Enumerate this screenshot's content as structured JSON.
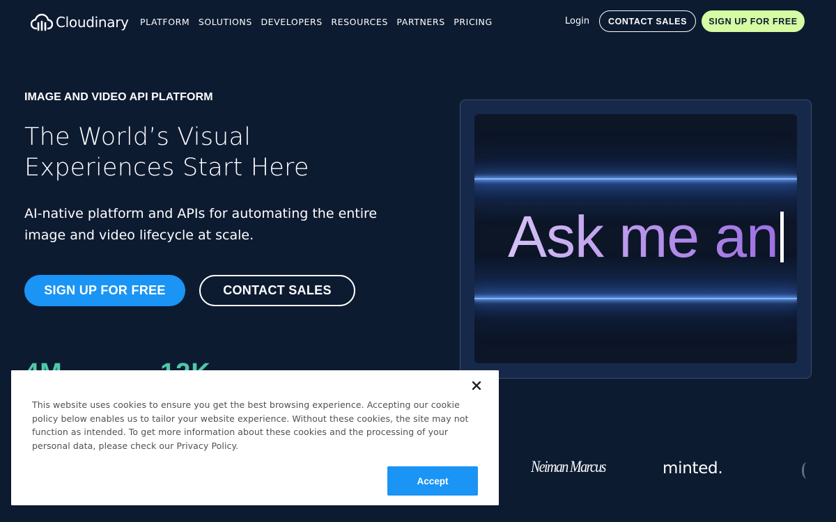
{
  "header": {
    "brand": "Cloudinary",
    "nav": [
      "PLATFORM",
      "SOLUTIONS",
      "DEVELOPERS",
      "RESOURCES",
      "PARTNERS",
      "PRICING"
    ],
    "login_label": "Login",
    "contact_label": "CONTACT SALES",
    "signup_label": "SIGN UP FOR FREE"
  },
  "hero": {
    "eyebrow": "IMAGE AND VIDEO API PLATFORM",
    "headline": "The World’s Visual Experiences Start Here",
    "subtext": "AI-native platform and APIs for automating the entire image and video lifecycle at scale.",
    "signup_label": "SIGN UP FOR FREE",
    "contact_label": "CONTACT SALES",
    "stats": [
      "4M",
      "12K"
    ],
    "typed_text": "Ask me an"
  },
  "logos": {
    "neiman": "Neiman Marcus",
    "minted": "minted."
  },
  "cookie": {
    "text": "This website uses cookies to ensure you get the best browsing experience. Accepting our cookie policy below enables us to tailor your website experience. Without these cookies, the site may not function as intended. To get more information about these cookies and the processing of your personal data, please check our Privacy Policy.",
    "accept_label": "Accept"
  },
  "colors": {
    "background": "#0d1b31",
    "primary_blue": "#1a94f5",
    "signup_green": "#d5fba3",
    "stat_teal": "#4ec9a8"
  },
  "icons": {
    "logo": "cloudinary-cloud-icon",
    "close": "close-icon"
  }
}
